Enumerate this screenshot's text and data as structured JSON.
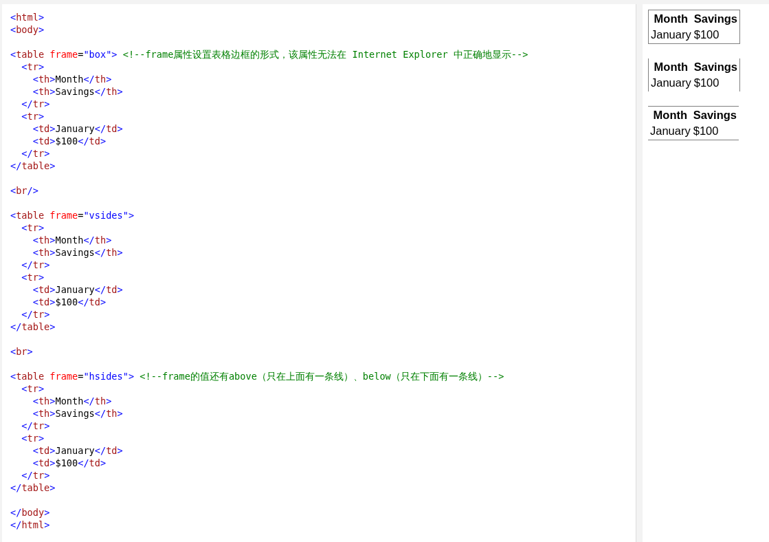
{
  "editor": {
    "lines": [
      {
        "kind": "code",
        "tokens": [
          {
            "kind": "p",
            "text": "<"
          },
          {
            "kind": "tag",
            "text": "html"
          },
          {
            "kind": "p",
            "text": ">"
          }
        ]
      },
      {
        "kind": "code",
        "tokens": [
          {
            "kind": "p",
            "text": "<"
          },
          {
            "kind": "tag",
            "text": "body"
          },
          {
            "kind": "p",
            "text": ">"
          }
        ]
      },
      {
        "kind": "blank"
      },
      {
        "kind": "code",
        "tokens": [
          {
            "kind": "p",
            "text": "<"
          },
          {
            "kind": "tag",
            "text": "table "
          },
          {
            "kind": "attr",
            "text": "frame"
          },
          {
            "kind": "txt",
            "text": "="
          },
          {
            "kind": "val",
            "text": "\"box\""
          },
          {
            "kind": "p",
            "text": "> "
          },
          {
            "kind": "cmt",
            "text": "<!--frame属性设置表格边框的形式，该属性无法在 Internet Explorer 中正确地显示-->"
          }
        ]
      },
      {
        "kind": "code",
        "tokens": [
          {
            "kind": "p",
            "text": "  <"
          },
          {
            "kind": "tag",
            "text": "tr"
          },
          {
            "kind": "p",
            "text": ">"
          }
        ]
      },
      {
        "kind": "code",
        "tokens": [
          {
            "kind": "p",
            "text": "    <"
          },
          {
            "kind": "tag",
            "text": "th"
          },
          {
            "kind": "p",
            "text": ">"
          },
          {
            "kind": "txt",
            "text": "Month"
          },
          {
            "kind": "p",
            "text": "</"
          },
          {
            "kind": "tag",
            "text": "th"
          },
          {
            "kind": "p",
            "text": ">"
          }
        ]
      },
      {
        "kind": "code",
        "tokens": [
          {
            "kind": "p",
            "text": "    <"
          },
          {
            "kind": "tag",
            "text": "th"
          },
          {
            "kind": "p",
            "text": ">"
          },
          {
            "kind": "txt",
            "text": "Savings"
          },
          {
            "kind": "p",
            "text": "</"
          },
          {
            "kind": "tag",
            "text": "th"
          },
          {
            "kind": "p",
            "text": ">"
          }
        ]
      },
      {
        "kind": "code",
        "tokens": [
          {
            "kind": "p",
            "text": "  </"
          },
          {
            "kind": "tag",
            "text": "tr"
          },
          {
            "kind": "p",
            "text": ">"
          }
        ]
      },
      {
        "kind": "code",
        "tokens": [
          {
            "kind": "p",
            "text": "  <"
          },
          {
            "kind": "tag",
            "text": "tr"
          },
          {
            "kind": "p",
            "text": ">"
          }
        ]
      },
      {
        "kind": "code",
        "tokens": [
          {
            "kind": "p",
            "text": "    <"
          },
          {
            "kind": "tag",
            "text": "td"
          },
          {
            "kind": "p",
            "text": ">"
          },
          {
            "kind": "txt",
            "text": "January"
          },
          {
            "kind": "p",
            "text": "</"
          },
          {
            "kind": "tag",
            "text": "td"
          },
          {
            "kind": "p",
            "text": ">"
          }
        ]
      },
      {
        "kind": "code",
        "tokens": [
          {
            "kind": "p",
            "text": "    <"
          },
          {
            "kind": "tag",
            "text": "td"
          },
          {
            "kind": "p",
            "text": ">"
          },
          {
            "kind": "txt",
            "text": "$100"
          },
          {
            "kind": "p",
            "text": "</"
          },
          {
            "kind": "tag",
            "text": "td"
          },
          {
            "kind": "p",
            "text": ">"
          }
        ]
      },
      {
        "kind": "code",
        "tokens": [
          {
            "kind": "p",
            "text": "  </"
          },
          {
            "kind": "tag",
            "text": "tr"
          },
          {
            "kind": "p",
            "text": ">"
          }
        ]
      },
      {
        "kind": "code",
        "tokens": [
          {
            "kind": "p",
            "text": "</"
          },
          {
            "kind": "tag",
            "text": "table"
          },
          {
            "kind": "p",
            "text": ">"
          }
        ]
      },
      {
        "kind": "blank"
      },
      {
        "kind": "code",
        "tokens": [
          {
            "kind": "p",
            "text": "<"
          },
          {
            "kind": "tag",
            "text": "br"
          },
          {
            "kind": "p",
            "text": "/>"
          }
        ]
      },
      {
        "kind": "blank"
      },
      {
        "kind": "code",
        "tokens": [
          {
            "kind": "p",
            "text": "<"
          },
          {
            "kind": "tag",
            "text": "table "
          },
          {
            "kind": "attr",
            "text": "frame"
          },
          {
            "kind": "txt",
            "text": "="
          },
          {
            "kind": "val",
            "text": "\"vsides\""
          },
          {
            "kind": "p",
            "text": ">"
          }
        ]
      },
      {
        "kind": "code",
        "tokens": [
          {
            "kind": "p",
            "text": "  <"
          },
          {
            "kind": "tag",
            "text": "tr"
          },
          {
            "kind": "p",
            "text": ">"
          }
        ]
      },
      {
        "kind": "code",
        "tokens": [
          {
            "kind": "p",
            "text": "    <"
          },
          {
            "kind": "tag",
            "text": "th"
          },
          {
            "kind": "p",
            "text": ">"
          },
          {
            "kind": "txt",
            "text": "Month"
          },
          {
            "kind": "p",
            "text": "</"
          },
          {
            "kind": "tag",
            "text": "th"
          },
          {
            "kind": "p",
            "text": ">"
          }
        ]
      },
      {
        "kind": "code",
        "tokens": [
          {
            "kind": "p",
            "text": "    <"
          },
          {
            "kind": "tag",
            "text": "th"
          },
          {
            "kind": "p",
            "text": ">"
          },
          {
            "kind": "txt",
            "text": "Savings"
          },
          {
            "kind": "p",
            "text": "</"
          },
          {
            "kind": "tag",
            "text": "th"
          },
          {
            "kind": "p",
            "text": ">"
          }
        ]
      },
      {
        "kind": "code",
        "tokens": [
          {
            "kind": "p",
            "text": "  </"
          },
          {
            "kind": "tag",
            "text": "tr"
          },
          {
            "kind": "p",
            "text": ">"
          }
        ]
      },
      {
        "kind": "code",
        "tokens": [
          {
            "kind": "p",
            "text": "  <"
          },
          {
            "kind": "tag",
            "text": "tr"
          },
          {
            "kind": "p",
            "text": ">"
          }
        ]
      },
      {
        "kind": "code",
        "tokens": [
          {
            "kind": "p",
            "text": "    <"
          },
          {
            "kind": "tag",
            "text": "td"
          },
          {
            "kind": "p",
            "text": ">"
          },
          {
            "kind": "txt",
            "text": "January"
          },
          {
            "kind": "p",
            "text": "</"
          },
          {
            "kind": "tag",
            "text": "td"
          },
          {
            "kind": "p",
            "text": ">"
          }
        ]
      },
      {
        "kind": "code",
        "tokens": [
          {
            "kind": "p",
            "text": "    <"
          },
          {
            "kind": "tag",
            "text": "td"
          },
          {
            "kind": "p",
            "text": ">"
          },
          {
            "kind": "txt",
            "text": "$100"
          },
          {
            "kind": "p",
            "text": "</"
          },
          {
            "kind": "tag",
            "text": "td"
          },
          {
            "kind": "p",
            "text": ">"
          }
        ]
      },
      {
        "kind": "code",
        "tokens": [
          {
            "kind": "p",
            "text": "  </"
          },
          {
            "kind": "tag",
            "text": "tr"
          },
          {
            "kind": "p",
            "text": ">"
          }
        ]
      },
      {
        "kind": "code",
        "tokens": [
          {
            "kind": "p",
            "text": "</"
          },
          {
            "kind": "tag",
            "text": "table"
          },
          {
            "kind": "p",
            "text": ">"
          }
        ]
      },
      {
        "kind": "blank"
      },
      {
        "kind": "code",
        "tokens": [
          {
            "kind": "p",
            "text": "<"
          },
          {
            "kind": "tag",
            "text": "br"
          },
          {
            "kind": "p",
            "text": ">"
          }
        ]
      },
      {
        "kind": "blank"
      },
      {
        "kind": "code",
        "tokens": [
          {
            "kind": "p",
            "text": "<"
          },
          {
            "kind": "tag",
            "text": "table "
          },
          {
            "kind": "attr",
            "text": "frame"
          },
          {
            "kind": "txt",
            "text": "="
          },
          {
            "kind": "val",
            "text": "\"hsides\""
          },
          {
            "kind": "p",
            "text": "> "
          },
          {
            "kind": "cmt",
            "text": "<!--frame的值还有above（只在上面有一条线）、below（只在下面有一条线）-->"
          }
        ]
      },
      {
        "kind": "code",
        "tokens": [
          {
            "kind": "p",
            "text": "  <"
          },
          {
            "kind": "tag",
            "text": "tr"
          },
          {
            "kind": "p",
            "text": ">"
          }
        ]
      },
      {
        "kind": "code",
        "tokens": [
          {
            "kind": "p",
            "text": "    <"
          },
          {
            "kind": "tag",
            "text": "th"
          },
          {
            "kind": "p",
            "text": ">"
          },
          {
            "kind": "txt",
            "text": "Month"
          },
          {
            "kind": "p",
            "text": "</"
          },
          {
            "kind": "tag",
            "text": "th"
          },
          {
            "kind": "p",
            "text": ">"
          }
        ]
      },
      {
        "kind": "code",
        "tokens": [
          {
            "kind": "p",
            "text": "    <"
          },
          {
            "kind": "tag",
            "text": "th"
          },
          {
            "kind": "p",
            "text": ">"
          },
          {
            "kind": "txt",
            "text": "Savings"
          },
          {
            "kind": "p",
            "text": "</"
          },
          {
            "kind": "tag",
            "text": "th"
          },
          {
            "kind": "p",
            "text": ">"
          }
        ]
      },
      {
        "kind": "code",
        "tokens": [
          {
            "kind": "p",
            "text": "  </"
          },
          {
            "kind": "tag",
            "text": "tr"
          },
          {
            "kind": "p",
            "text": ">"
          }
        ]
      },
      {
        "kind": "code",
        "tokens": [
          {
            "kind": "p",
            "text": "  <"
          },
          {
            "kind": "tag",
            "text": "tr"
          },
          {
            "kind": "p",
            "text": ">"
          }
        ]
      },
      {
        "kind": "code",
        "tokens": [
          {
            "kind": "p",
            "text": "    <"
          },
          {
            "kind": "tag",
            "text": "td"
          },
          {
            "kind": "p",
            "text": ">"
          },
          {
            "kind": "txt",
            "text": "January"
          },
          {
            "kind": "p",
            "text": "</"
          },
          {
            "kind": "tag",
            "text": "td"
          },
          {
            "kind": "p",
            "text": ">"
          }
        ]
      },
      {
        "kind": "code",
        "tokens": [
          {
            "kind": "p",
            "text": "    <"
          },
          {
            "kind": "tag",
            "text": "td"
          },
          {
            "kind": "p",
            "text": ">"
          },
          {
            "kind": "txt",
            "text": "$100"
          },
          {
            "kind": "p",
            "text": "</"
          },
          {
            "kind": "tag",
            "text": "td"
          },
          {
            "kind": "p",
            "text": ">"
          }
        ]
      },
      {
        "kind": "code",
        "tokens": [
          {
            "kind": "p",
            "text": "  </"
          },
          {
            "kind": "tag",
            "text": "tr"
          },
          {
            "kind": "p",
            "text": ">"
          }
        ]
      },
      {
        "kind": "code",
        "tokens": [
          {
            "kind": "p",
            "text": "</"
          },
          {
            "kind": "tag",
            "text": "table"
          },
          {
            "kind": "p",
            "text": ">"
          }
        ]
      },
      {
        "kind": "blank"
      },
      {
        "kind": "code",
        "tokens": [
          {
            "kind": "p",
            "text": "</"
          },
          {
            "kind": "tag",
            "text": "body"
          },
          {
            "kind": "p",
            "text": ">"
          }
        ]
      },
      {
        "kind": "code",
        "tokens": [
          {
            "kind": "p",
            "text": "</"
          },
          {
            "kind": "tag",
            "text": "html"
          },
          {
            "kind": "p",
            "text": ">"
          }
        ]
      }
    ]
  },
  "preview": {
    "tables": [
      {
        "kind": "box",
        "header": [
          "Month",
          "Savings"
        ],
        "row": [
          "January",
          "$100"
        ]
      },
      {
        "kind": "vsides",
        "header": [
          "Month",
          "Savings"
        ],
        "row": [
          "January",
          "$100"
        ]
      },
      {
        "kind": "hsides",
        "header": [
          "Month",
          "Savings"
        ],
        "row": [
          "January",
          "$100"
        ]
      }
    ]
  }
}
